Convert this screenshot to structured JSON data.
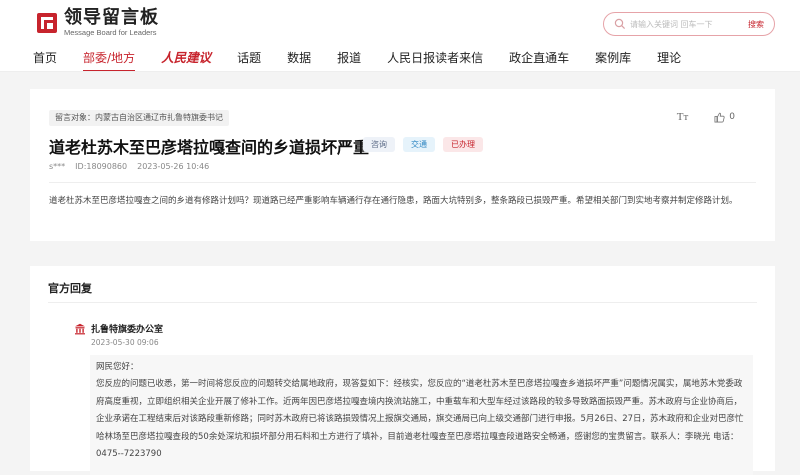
{
  "header": {
    "logo_title": "领导留言板",
    "logo_subtitle": "Message Board for Leaders",
    "brand_color": "#c7242d",
    "search": {
      "placeholder": "请输入关键词 回车一下",
      "button_label": "搜索",
      "icon": "search-icon"
    }
  },
  "nav": {
    "items": [
      {
        "label": "首页"
      },
      {
        "label": "部委/地方"
      },
      {
        "label": "人民建议"
      },
      {
        "label": "话题"
      },
      {
        "label": "数据"
      },
      {
        "label": "报道"
      },
      {
        "label": "人民日报读者来信"
      },
      {
        "label": "政企直通车"
      },
      {
        "label": "案例库"
      },
      {
        "label": "理论"
      }
    ],
    "active_index": 1
  },
  "question": {
    "target": "留言对象：内蒙古自治区通辽市扎鲁特旗委书记",
    "title": "道老杜苏木至巴彦塔拉嘎查间的乡道损坏严重",
    "badges": {
      "type": "咨询",
      "field": "交通",
      "status": "已办理"
    },
    "font_tool": "Tт",
    "like_count": "0",
    "author": "s***",
    "id": "ID:18090860",
    "datetime": "2023-05-26 10:46",
    "body": "道老杜苏木至巴彦塔拉嘎查之间的乡道有修路计划吗？现道路已经严重影响车辆通行存在通行隐患，路面大坑特别多，整条路段已损毁严重。希望相关部门到实地考察并制定修路计划。"
  },
  "reply": {
    "heading": "官方回复",
    "org": "扎鲁特旗委办公室",
    "date": "2023-05-30 09:06",
    "greeting": "网民您好：",
    "body": "您反应的问题已收悉，第一时间将您反应的问题转交给属地政府，现答复如下：经核实，您反应的“道老杜苏木至巴彦塔拉嘎查乡道损坏严重”问题情况属实，属地苏木党委政府高度重视，立即组织相关企业开展了修补工作。近两年因巴彦塔拉嘎查境内换流站施工，中重载车和大型车经过该路段的较多导致路面损毁严重。苏木政府与企业协商后，企业承诺在工程结束后对该路段重新修路；同时苏木政府已将该路损毁情况上报旗交通局，旗交通局已向上级交通部门进行申报。5月26日、27日，苏木政府和企业对巴彦忙哈林场至巴彦塔拉嘎查段的50余处深坑和损坏部分用石料和土方进行了填补，目前道老杜嘎查至巴彦塔拉嘎查段道路安全畅通，感谢您的宝贵留言。联系人：李晓光 电话：",
    "phone": "0475--7223790"
  }
}
